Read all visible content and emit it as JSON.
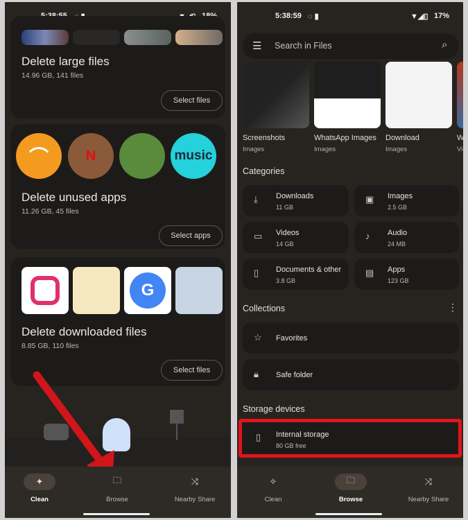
{
  "left": {
    "status": {
      "time": "5:38:55",
      "battery": "18%"
    },
    "cards": [
      {
        "title": "Delete large files",
        "subtitle": "14.96 GB, 141 files",
        "button": "Select files"
      },
      {
        "title": "Delete unused apps",
        "subtitle": "11.26 GB, 45 files",
        "button": "Select apps",
        "apps": [
          "Audible",
          "Netflix",
          "Game",
          "music"
        ]
      },
      {
        "title": "Delete downloaded files",
        "subtitle": "8.85 GB, 110 files",
        "button": "Select files"
      }
    ],
    "nav": [
      {
        "label": "Clean",
        "icon": "sparkle-icon",
        "active": true
      },
      {
        "label": "Browse",
        "icon": "folder-search-icon",
        "active": false
      },
      {
        "label": "Nearby Share",
        "icon": "nearby-share-icon",
        "active": false
      }
    ]
  },
  "right": {
    "status": {
      "time": "5:38:59",
      "battery": "17%"
    },
    "search_placeholder": "Search in Files",
    "folders": [
      {
        "name": "Screenshots",
        "type": "Images"
      },
      {
        "name": "WhatsApp Images",
        "type": "Images"
      },
      {
        "name": "Download",
        "type": "Images"
      },
      {
        "name": "Wh",
        "type": "Vid"
      }
    ],
    "categories_title": "Categories",
    "categories": [
      {
        "name": "Downloads",
        "size": "11 GB",
        "icon": "download-icon"
      },
      {
        "name": "Images",
        "size": "2.5 GB",
        "icon": "image-icon"
      },
      {
        "name": "Videos",
        "size": "14 GB",
        "icon": "video-icon"
      },
      {
        "name": "Audio",
        "size": "24 MB",
        "icon": "music-note-icon"
      },
      {
        "name": "Documents & other",
        "size": "3.8 GB",
        "icon": "document-icon"
      },
      {
        "name": "Apps",
        "size": "123 GB",
        "icon": "android-icon"
      }
    ],
    "collections_title": "Collections",
    "collections": [
      {
        "name": "Favorites",
        "icon": "star-icon"
      },
      {
        "name": "Safe folder",
        "icon": "lock-icon"
      }
    ],
    "storage_title": "Storage devices",
    "storage": {
      "name": "Internal storage",
      "free": "80 GB free"
    },
    "nav": [
      {
        "label": "Clean",
        "active": false
      },
      {
        "label": "Browse",
        "active": true
      },
      {
        "label": "Nearby Share",
        "active": false
      }
    ]
  },
  "colors": {
    "highlight": "#e0141b",
    "arrow": "#d0161b"
  }
}
